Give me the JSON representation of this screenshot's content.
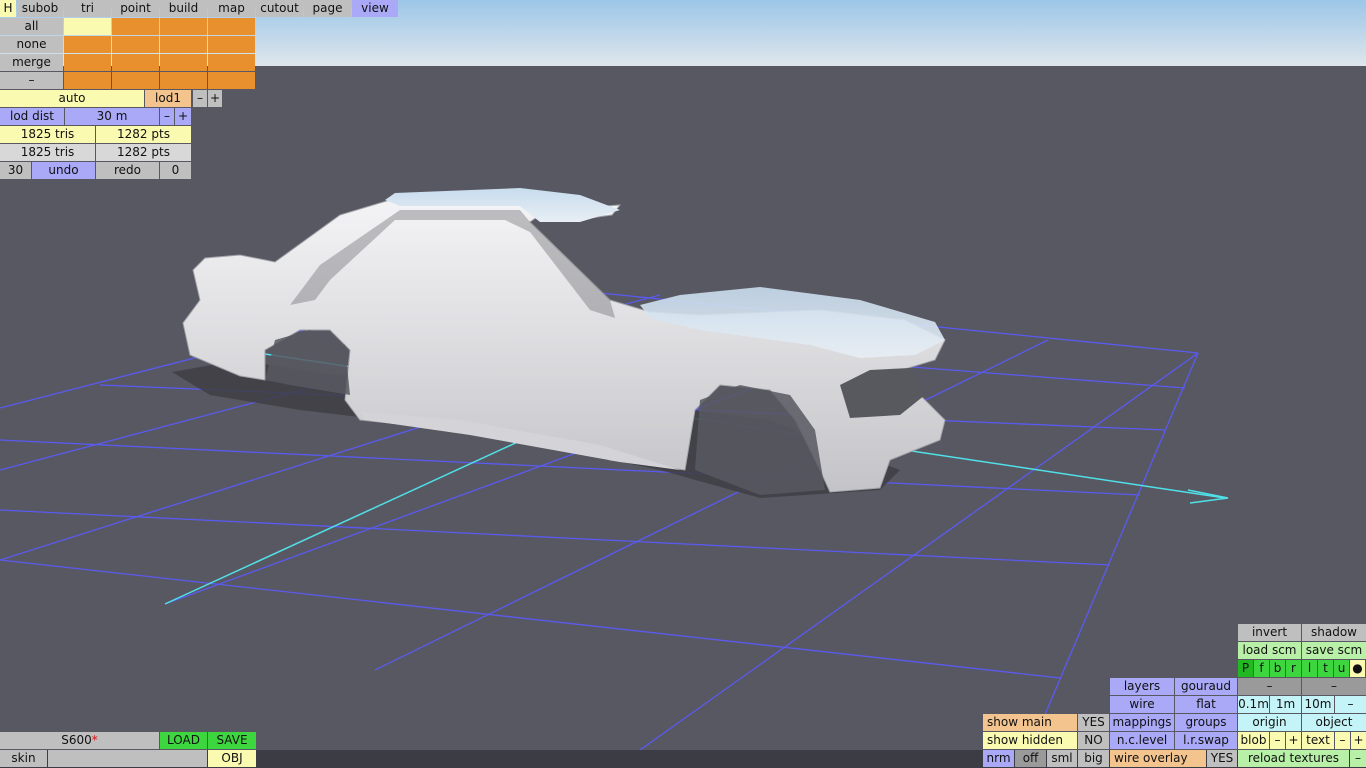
{
  "top_menu": {
    "h_label": "H",
    "tabs": [
      "subob",
      "tri",
      "point",
      "build",
      "map",
      "cutout",
      "page",
      "view"
    ],
    "active_tab": "view"
  },
  "selection_panel": {
    "rows": [
      "all",
      "none",
      "merge",
      "–"
    ]
  },
  "lod_panel": {
    "auto_label": "auto",
    "lod_value": "lod1",
    "minus": "–",
    "plus": "+",
    "lod_dist_label": "lod dist",
    "lod_dist_value": "30 m",
    "tris_1": "1825 tris",
    "pts_1": "1282 pts",
    "tris_2": "1825 tris",
    "pts_2": "1282 pts",
    "undo_count": "30",
    "undo_label": "undo",
    "redo_label": "redo",
    "redo_count": "0"
  },
  "file_panel": {
    "filename": "S600",
    "modified_marker": "*",
    "load_label": "LOAD",
    "save_label": "SAVE",
    "skin_label": "skin",
    "skin_value": "",
    "obj_label": "OBJ"
  },
  "view_panel": {
    "invert": "invert",
    "shadow": "shadow",
    "load_scm": "load scm",
    "save_scm": "save scm",
    "view_buttons": [
      "P",
      "f",
      "b",
      "r",
      "l",
      "t",
      "u",
      "●"
    ],
    "layers": "layers",
    "gouraud": "gouraud",
    "dash1": "–",
    "dash2": "–",
    "wire": "wire",
    "flat": "flat",
    "grid_01": "0.1m",
    "grid_1": "1m",
    "grid_10": "10m",
    "grid_dash": "–",
    "show_main": "show main",
    "show_main_val": "YES",
    "mappings": "mappings",
    "groups": "groups",
    "origin": "origin",
    "object": "object",
    "show_hidden": "show hidden",
    "show_hidden_val": "NO",
    "nc_level": "n.c.level",
    "lr_swap": "l.r.swap",
    "blob": "blob",
    "blob_minus": "–",
    "blob_plus": "+",
    "text": "text",
    "text_minus": "–",
    "text_plus": "+",
    "nrm": "nrm",
    "off": "off",
    "sml": "sml",
    "big": "big",
    "wire_overlay": "wire overlay",
    "wire_overlay_val": "YES",
    "reload_textures": "reload textures",
    "reload_dash": "–"
  }
}
